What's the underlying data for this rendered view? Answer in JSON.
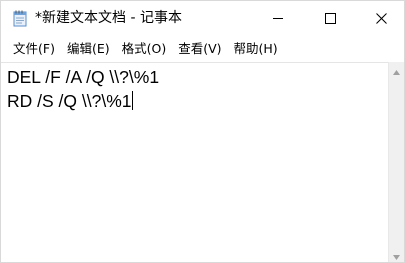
{
  "window": {
    "title": "*新建文本文档 - 记事本",
    "app_icon": "notepad-icon",
    "controls": {
      "minimize": "minimize-icon",
      "maximize": "maximize-icon",
      "close": "close-icon"
    }
  },
  "menu": {
    "items": [
      {
        "label": "文件(F)"
      },
      {
        "label": "编辑(E)"
      },
      {
        "label": "格式(O)"
      },
      {
        "label": "查看(V)"
      },
      {
        "label": "帮助(H)"
      }
    ]
  },
  "editor": {
    "lines": [
      "DEL /F /A /Q \\\\?\\%1",
      "RD /S /Q \\\\?\\%1"
    ]
  },
  "colors": {
    "background": "#ffffff",
    "text": "#000000",
    "scrollbar": "#f0f0f0"
  }
}
